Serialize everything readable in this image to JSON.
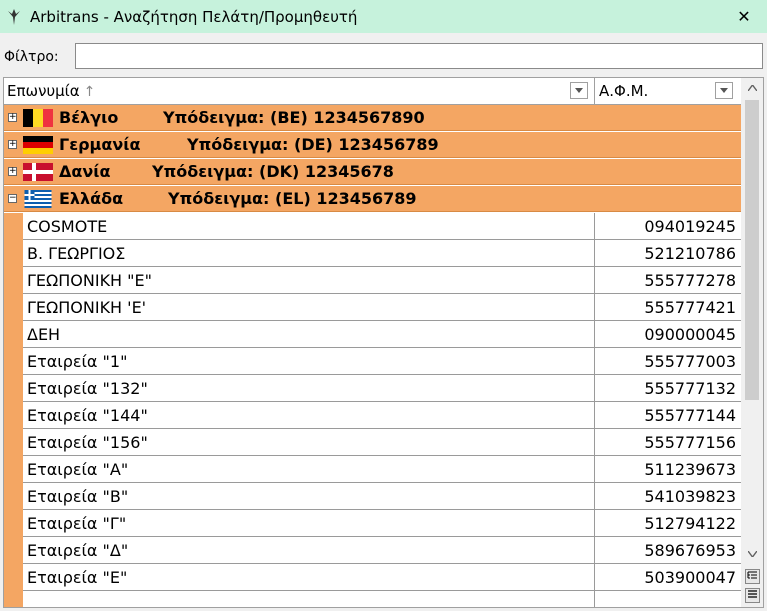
{
  "window": {
    "title": "Arbitrans - Αναζήτηση Πελάτη/Προμηθευτή",
    "close_label": "✕"
  },
  "filter": {
    "label": "Φίλτρο:",
    "value": ""
  },
  "grid": {
    "columns": [
      "Επωνυμία",
      "Α.Φ.Μ."
    ],
    "groups": [
      {
        "country": "Βέλγιο",
        "example": "Υπόδειγμα: (BE) 1234567890",
        "expanded": false,
        "toggle": "+"
      },
      {
        "country": "Γερμανία",
        "example": "Υπόδειγμα: (DE) 123456789",
        "expanded": false,
        "toggle": "+"
      },
      {
        "country": "Δανία",
        "example": "Υπόδειγμα: (DK) 12345678",
        "expanded": false,
        "toggle": "+"
      },
      {
        "country": "Ελλάδα",
        "example": "Υπόδειγμα: (EL) 123456789",
        "expanded": true,
        "toggle": "−"
      }
    ],
    "rows": [
      {
        "name": "COSMOTE",
        "afm": "094019245"
      },
      {
        "name": "Β. ΓΕΩΡΓΙΟΣ",
        "afm": "521210786"
      },
      {
        "name": "ΓΕΩΠΟΝΙΚΗ \"Ε\"",
        "afm": "555777278"
      },
      {
        "name": "ΓΕΩΠΟΝΙΚΗ 'Ε'",
        "afm": "555777421"
      },
      {
        "name": "ΔΕΗ",
        "afm": "090000045"
      },
      {
        "name": "Εταιρεία \"1\"",
        "afm": "555777003"
      },
      {
        "name": "Εταιρεία \"132\"",
        "afm": "555777132"
      },
      {
        "name": "Εταιρεία \"144\"",
        "afm": "555777144"
      },
      {
        "name": "Εταιρεία \"156\"",
        "afm": "555777156"
      },
      {
        "name": "Εταιρεία \"Α\"",
        "afm": "511239673"
      },
      {
        "name": "Εταιρεία \"Β\"",
        "afm": "541039823"
      },
      {
        "name": "Εταιρεία \"Γ\"",
        "afm": "512794122"
      },
      {
        "name": "Εταιρεία \"Δ\"",
        "afm": "589676953"
      },
      {
        "name": "Εταιρεία \"Ε\"",
        "afm": "503900047"
      }
    ]
  },
  "icons": {
    "sort": "sort-ascending-icon",
    "dropdown": "chevron-down-icon",
    "scroll_up": "scroll-up-icon",
    "scroll_down": "scroll-down-icon"
  },
  "colors": {
    "titlebar": "#c6f2dc",
    "group_band": "#f4a663"
  }
}
